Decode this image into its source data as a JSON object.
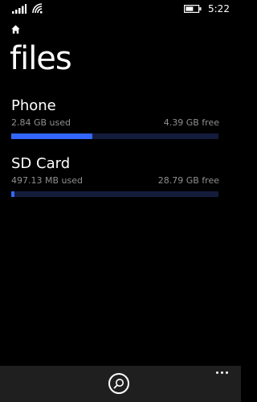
{
  "status_bar": {
    "time": "5:22",
    "icons": [
      "signal-icon",
      "wifi-icon",
      "battery-icon"
    ]
  },
  "header": {
    "home_icon": "home-icon",
    "title": "files"
  },
  "storage": [
    {
      "name": "Phone",
      "used": "2.84 GB used",
      "free": "4.39 GB free",
      "used_fraction": 0.393
    },
    {
      "name": "SD Card",
      "used": "497.13 MB used",
      "free": "28.79 GB free",
      "used_fraction": 0.017
    }
  ],
  "app_bar": {
    "search_icon": "search-icon",
    "more_icon": "more-icon"
  },
  "colors": {
    "background": "#000000",
    "accent": "#3366ff",
    "bar_track": "#141c3c",
    "secondary_text": "#8f8f8f",
    "app_bar": "#1f1f1f"
  }
}
